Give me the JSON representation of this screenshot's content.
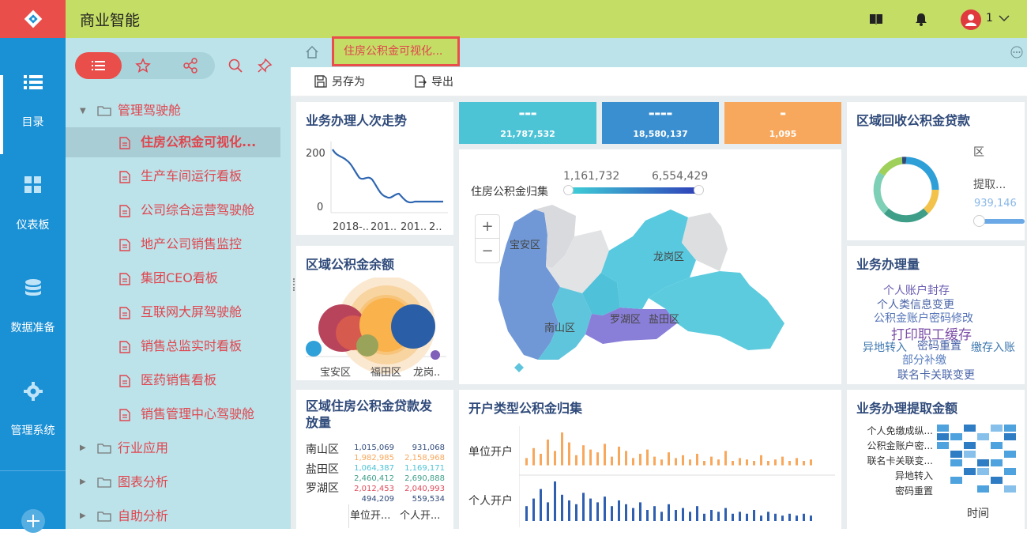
{
  "app": {
    "title": "商业智能",
    "user": "1"
  },
  "leftnav": {
    "items": [
      {
        "label": "目录"
      },
      {
        "label": "仪表板"
      },
      {
        "label": "数据准备"
      },
      {
        "label": "管理系统"
      }
    ]
  },
  "tree": {
    "root": "管理驾驶舱",
    "children": [
      "住房公积金可视化...",
      "生产车间运行看板",
      "公司综合运营驾驶舱",
      "地产公司销售监控",
      "集团CEO看板",
      "互联网大屏驾驶舱",
      "销售总监实时看板",
      "医药销售看板",
      "销售管理中心驾驶舱"
    ],
    "folders": [
      "行业应用",
      "图表分析",
      "自助分析"
    ]
  },
  "tab": {
    "label": "住房公积金可视化..."
  },
  "toolbar": {
    "save_as": "另存为",
    "export": "导出"
  },
  "cards": {
    "trend": {
      "title": "业务办理人次走势",
      "y_ticks": [
        "200",
        "0"
      ],
      "x_ticks": [
        "2018-..",
        "201..",
        "201..",
        "2.."
      ]
    },
    "kpi": [
      {
        "value": "21,787,532",
        "color": "#4dc3d6"
      },
      {
        "value": "18,580,137",
        "color": "#3a8fd0"
      },
      {
        "value": "1,095",
        "color": "#f8a85c"
      }
    ],
    "map": {
      "legend_title": "住房公积金归集",
      "min": "1,161,732",
      "max": "6,554,429",
      "zoom_in": "+",
      "zoom_out": "−",
      "districts": [
        "宝安区",
        "龙岗区",
        "南山区",
        "罗湖区",
        "盐田区"
      ]
    },
    "recovery": {
      "title": "区域回收公积金贷款",
      "label1": "区",
      "label2": "提取...",
      "value": "939,146"
    },
    "balance": {
      "title": "区域公积金余额",
      "x_ticks": [
        "宝安区",
        "福田区",
        "龙岗.."
      ]
    },
    "volume": {
      "title": "业务办理量",
      "words": [
        "个人账户封存",
        "个人类信息变更",
        "公积金账户密码修改",
        "打印职工缓存",
        "异地转入",
        "密码重置",
        "缴存入账",
        "部分补缴",
        "联名卡关联变更"
      ]
    },
    "loans": {
      "title": "区域住房公积金贷款发放量",
      "rows": [
        "南山区",
        "盐田区",
        "罗湖区"
      ],
      "col1": [
        "1,015,069",
        "1,982,985",
        "1,064,387",
        "2,460,412",
        "2,012,453",
        "494,209"
      ],
      "col2": [
        "931,068",
        "2,158,968",
        "1,169,171",
        "2,690,888",
        "2,040,993",
        "559,534"
      ],
      "colors": [
        "#2f4a7a",
        "#f8a85c",
        "#4dc3d6",
        "#3f9e88",
        "#e04a5a",
        "#2f4a7a"
      ],
      "footer": [
        "单位开...",
        "个人开..."
      ]
    },
    "account": {
      "title": "开户类型公积金归集",
      "series": [
        "单位开户",
        "个人开户"
      ]
    },
    "withdraw": {
      "title": "业务办理提取金额",
      "rows": [
        "个人免缴成纵...",
        "公积金账户密...",
        "联名卡关联变...",
        "异地转入",
        "密码重置"
      ],
      "xlabel": "时间"
    }
  }
}
